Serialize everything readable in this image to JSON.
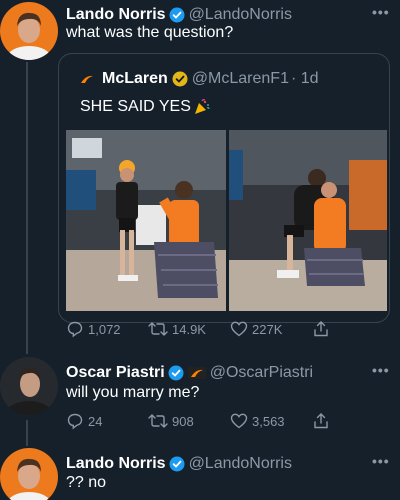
{
  "theme": {
    "background": "#15202b",
    "border": "#38444d",
    "muted": "#8b98a5",
    "verified": "#1d9bf0",
    "mclaren_orange": "#ff8000"
  },
  "tweets": [
    {
      "name": "Lando Norris",
      "handle": "@LandoNorris",
      "text": "what was the question?",
      "more": "•••",
      "verified_icon": "verified-badge-icon"
    },
    {
      "name": "Oscar Piastri",
      "handle": "@OscarPiastri",
      "text": "will you marry me?",
      "more": "•••",
      "verified_icon": "verified-badge-icon",
      "affiliate_icon": "mclaren-logo-icon",
      "actions": {
        "replies": "24",
        "retweets": "908",
        "likes": "3,563"
      }
    },
    {
      "name": "Lando Norris",
      "handle": "@LandoNorris",
      "text": "?? no",
      "more": "•••",
      "verified_icon": "verified-badge-icon"
    }
  ],
  "quoted": {
    "name": "McLaren",
    "handle": "@McLarenF1",
    "time": "· 1d",
    "text": "SHE SAID YES",
    "emoji_icon": "party-popper-icon",
    "verified_icon": "gold-verified-badge-icon",
    "actions": {
      "replies": "1,072",
      "retweets": "14.9K",
      "likes": "227K"
    }
  }
}
